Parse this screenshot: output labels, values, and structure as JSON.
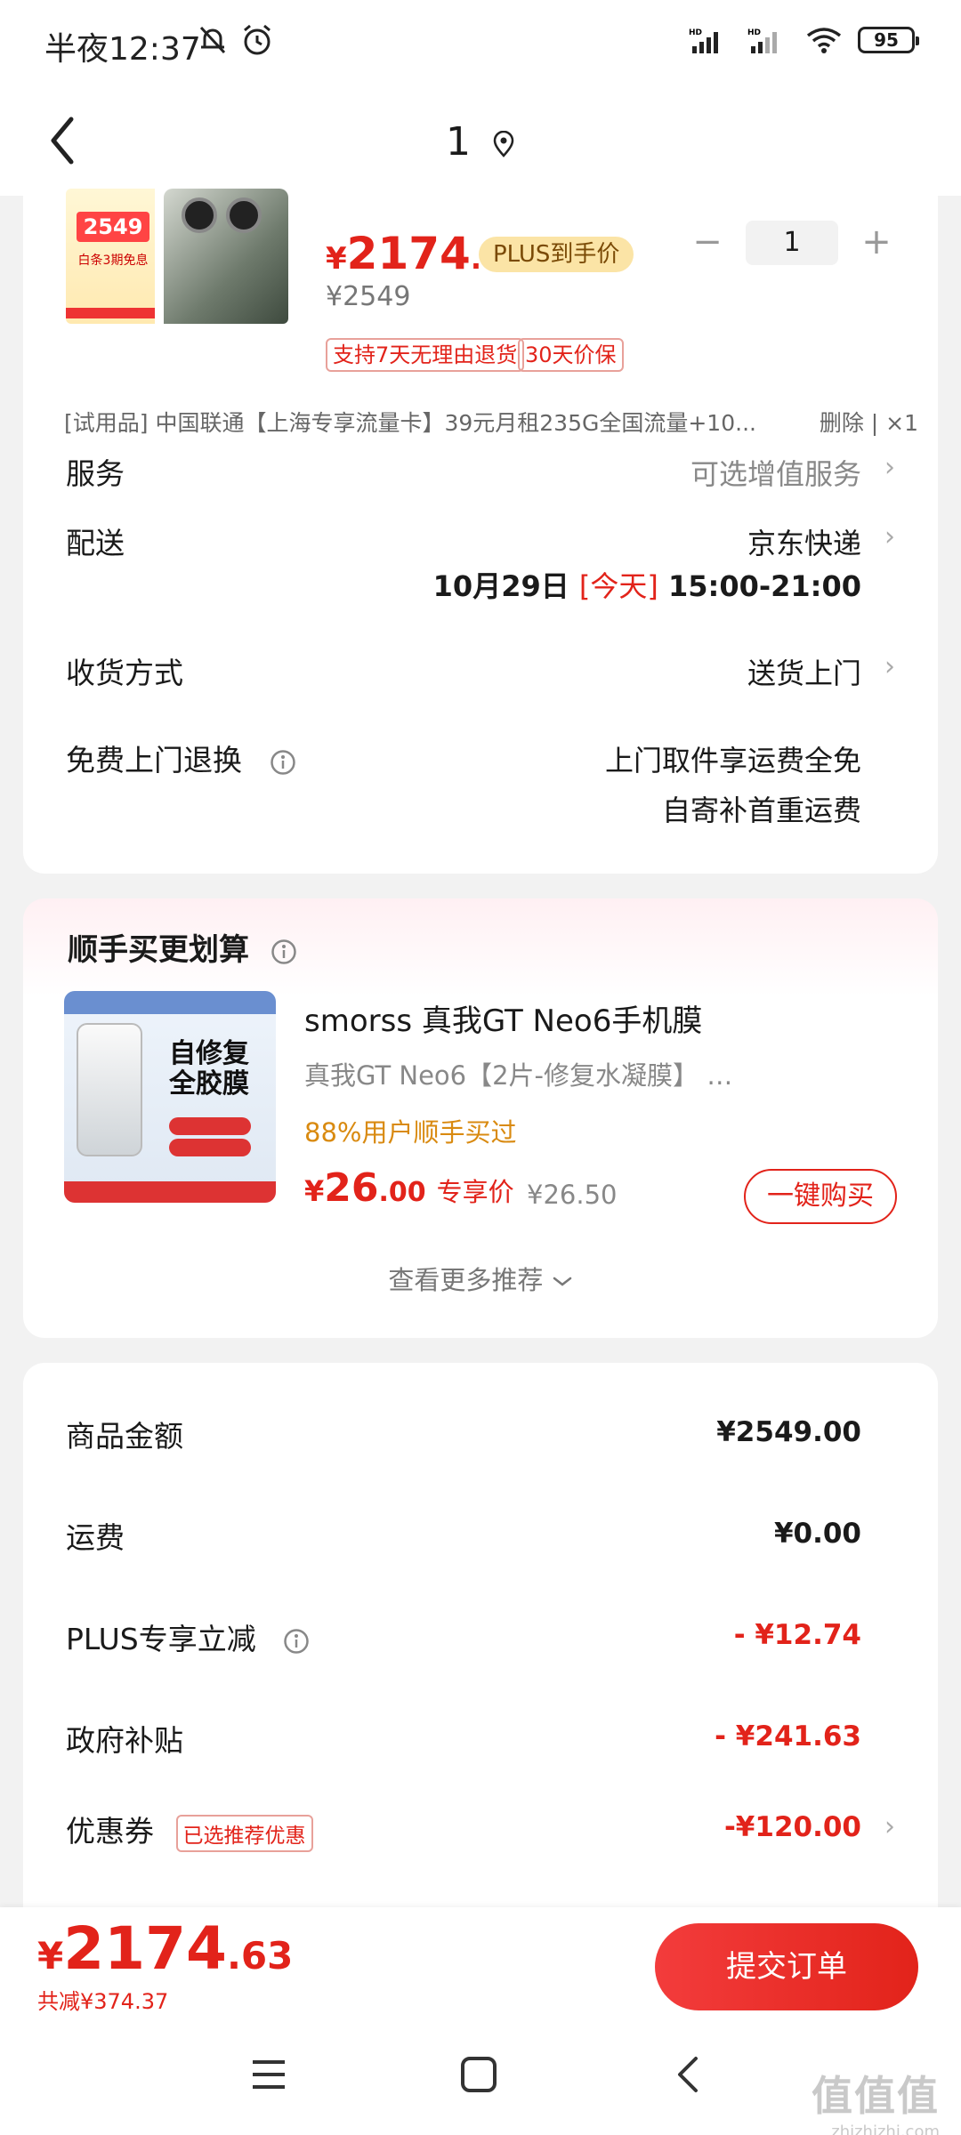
{
  "status_bar": {
    "time": "半夜12:37",
    "battery": "95"
  },
  "nav": {
    "title": "1"
  },
  "product": {
    "thumb": {
      "price_badge": "2549",
      "promo_line": "白条3期免息"
    },
    "price_currency": "¥",
    "price_int": "2174",
    "price_dec": ".63",
    "plus_badge": "PLUS到手价",
    "original_price": "¥2549",
    "tags": [
      "支持7天无理由退货",
      "30天价保"
    ],
    "quantity": "1",
    "trial_item": "[试用品]   中国联通【上海专享流量卡】39元月租235G全国流量+10...",
    "trial_actions": "删除 | ×1"
  },
  "rows": {
    "service": {
      "label": "服务",
      "value": "可选增值服务"
    },
    "delivery": {
      "label": "配送",
      "value": "京东快递",
      "date": "10月29日",
      "today": "[今天]",
      "time": "15:00-21:00"
    },
    "receive": {
      "label": "收货方式",
      "value": "送货上门"
    },
    "return": {
      "label": "免费上门退换",
      "value_1": "上门取件享运费全免",
      "value_2": "自寄补首重运费"
    }
  },
  "recommend": {
    "title": "顺手买更划算",
    "image_text": "自修复\n全胶膜",
    "name": "smorss 真我GT Neo6手机膜",
    "spec": "真我GT Neo6【2片-修复水凝膜】   …",
    "social": "88%用户顺手买过",
    "price_currency": "¥",
    "price_int": "26",
    "price_dec": ".00",
    "price_label": "专享价",
    "original_price": "¥26.50",
    "buy_button": "一键购买",
    "more": "查看更多推荐"
  },
  "summary": {
    "items": [
      {
        "label": "商品金额",
        "value": "¥2549.00"
      },
      {
        "label": "运费",
        "value": "¥0.00"
      },
      {
        "label": "PLUS专享立减",
        "value": "- ¥12.74"
      },
      {
        "label": "政府补贴",
        "value": "- ¥241.63"
      },
      {
        "label": "优惠券",
        "value": "-¥120.00",
        "tag": "已选推荐优惠"
      }
    ]
  },
  "bottom": {
    "total_currency": "¥",
    "total_int": "2174",
    "total_dec": ".63",
    "saved": "共减¥374.37",
    "submit": "提交订单"
  },
  "watermark": {
    "main": "值值值",
    "sub": "zhizhizhi.com"
  },
  "colors": {
    "accent": "#e2231a",
    "plus_badge": "#fbe4a6",
    "social": "#d98a10"
  }
}
